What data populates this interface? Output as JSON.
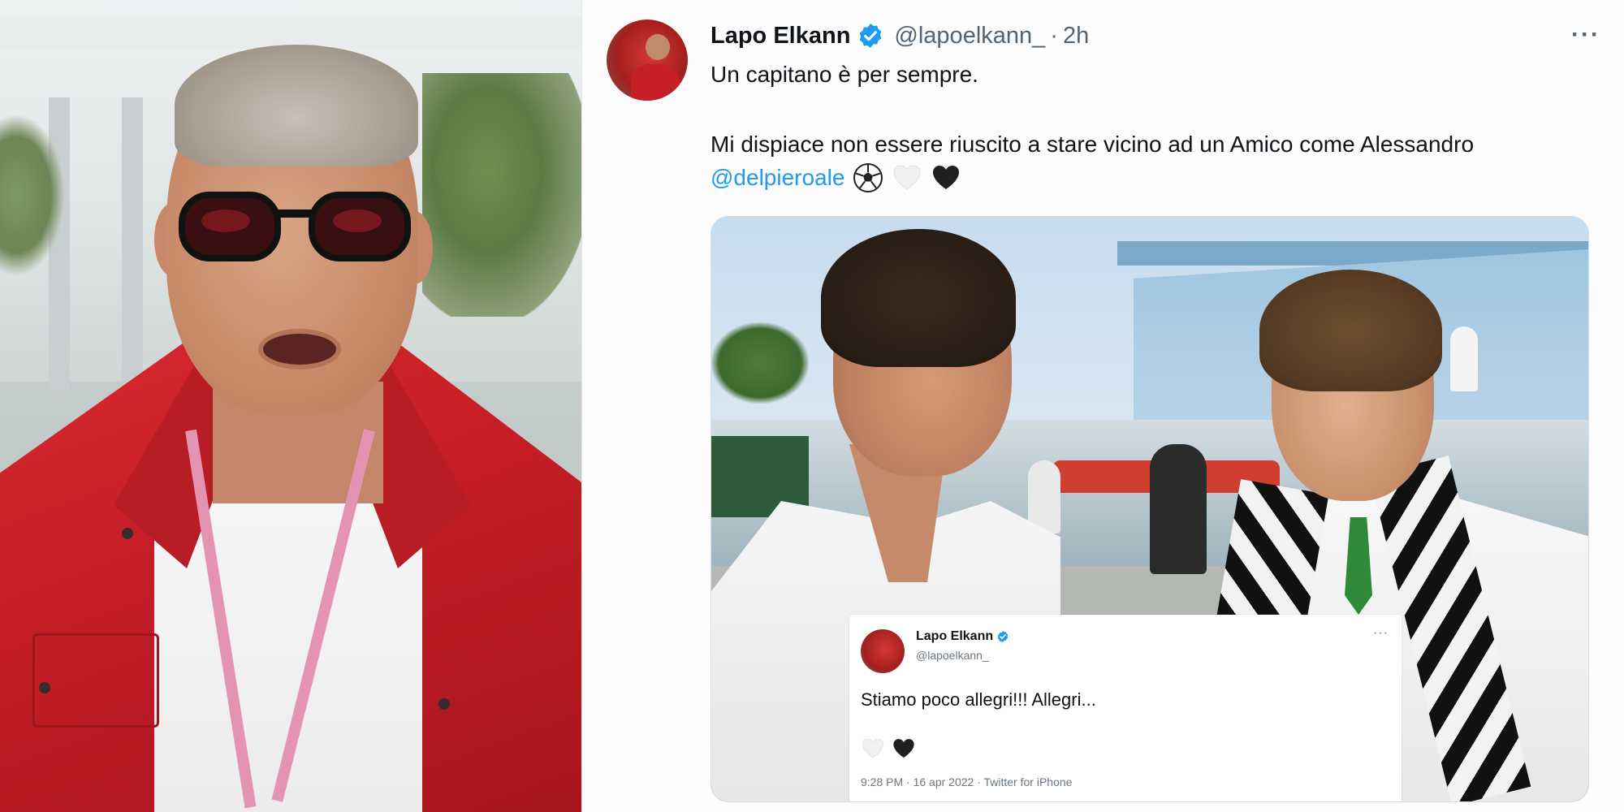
{
  "left_photo": {},
  "tweet": {
    "author_name": "Lapo Elkann",
    "handle": "@lapoelkann_",
    "separator": "·",
    "timeago": "2h",
    "more_label": "···",
    "line1": "Un capitano è per sempre.",
    "line2": "Mi dispiace non essere riuscito a stare vicino ad un Amico come Alessandro",
    "mention": "@delpieroale",
    "emojis": [
      "soccer-ball",
      "white-heart",
      "black-heart"
    ]
  },
  "quoted_tweet": {
    "author_name": "Lapo Elkann",
    "handle": "@lapoelkann_",
    "more_label": "···",
    "text": "Stiamo poco allegri!!! Allegri...",
    "hearts": [
      "white-heart",
      "black-heart"
    ],
    "footer": "9:28 PM · 16 apr 2022 · Twitter for iPhone"
  },
  "colors": {
    "link": "#1d9bf0",
    "verified": "#1d9bf0",
    "secondary_text": "#536471",
    "shirt_red": "#c51e27"
  }
}
